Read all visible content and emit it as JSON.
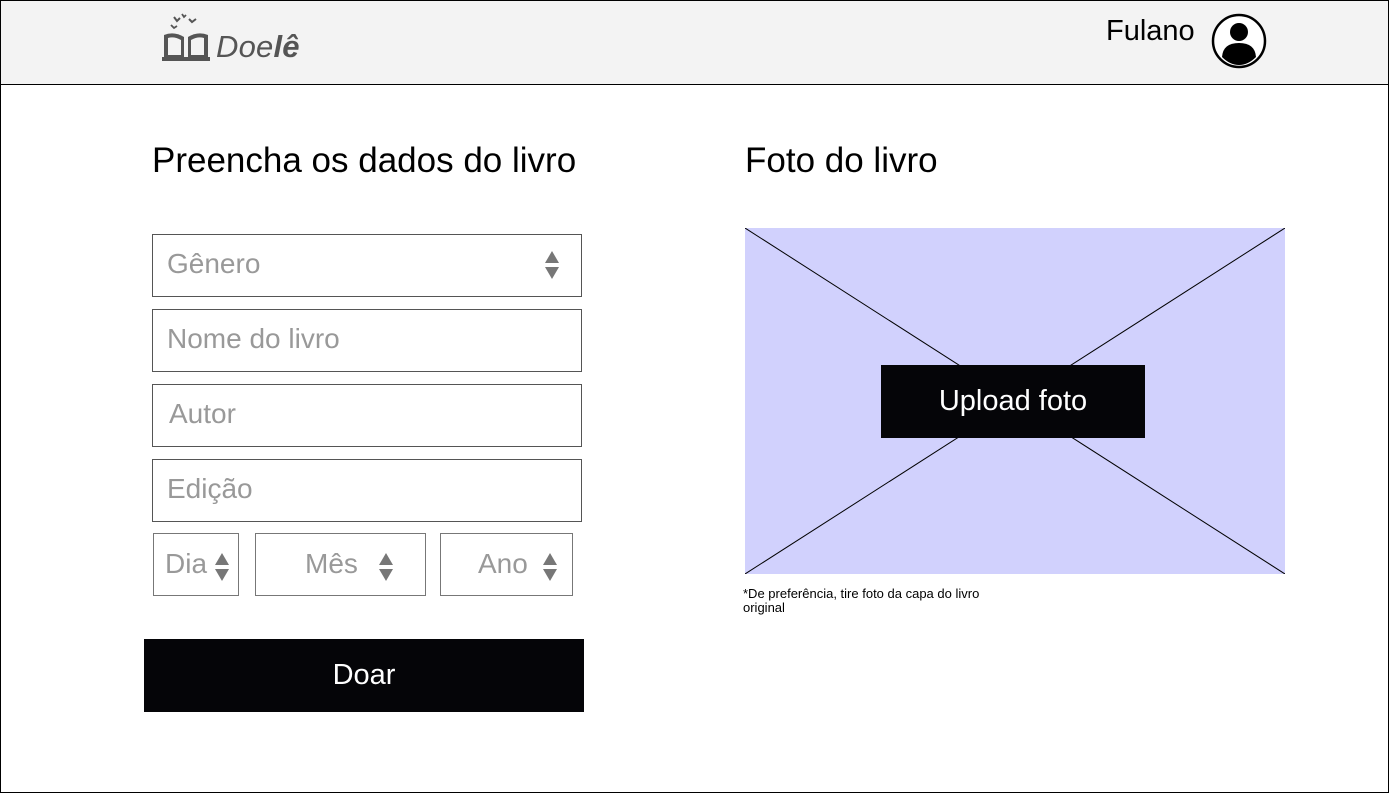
{
  "header": {
    "logo": {
      "text_light": "Doe",
      "text_bold": "lê",
      "icon": "book-birds-logo"
    },
    "user": {
      "name": "Fulano",
      "avatar_icon": "user-avatar-icon"
    }
  },
  "form": {
    "title": "Preencha os dados do livro",
    "fields": {
      "genero": {
        "placeholder": "Gênero"
      },
      "nome": {
        "placeholder": "Nome do livro"
      },
      "autor": {
        "placeholder": "Autor"
      },
      "edicao": {
        "placeholder": "Edição"
      },
      "dia": {
        "placeholder": "Dia"
      },
      "mes": {
        "placeholder": "Mês"
      },
      "ano": {
        "placeholder": "Ano"
      }
    },
    "submit_label": "Doar"
  },
  "photo": {
    "title": "Foto do livro",
    "upload_label": "Upload foto",
    "note": "*De preferência, tire foto da capa do livro original"
  },
  "colors": {
    "header_bg": "#f3f3f3",
    "button_bg": "#050508",
    "placeholder": "#999999",
    "image_placeholder_bg": "#d1d1fd"
  }
}
